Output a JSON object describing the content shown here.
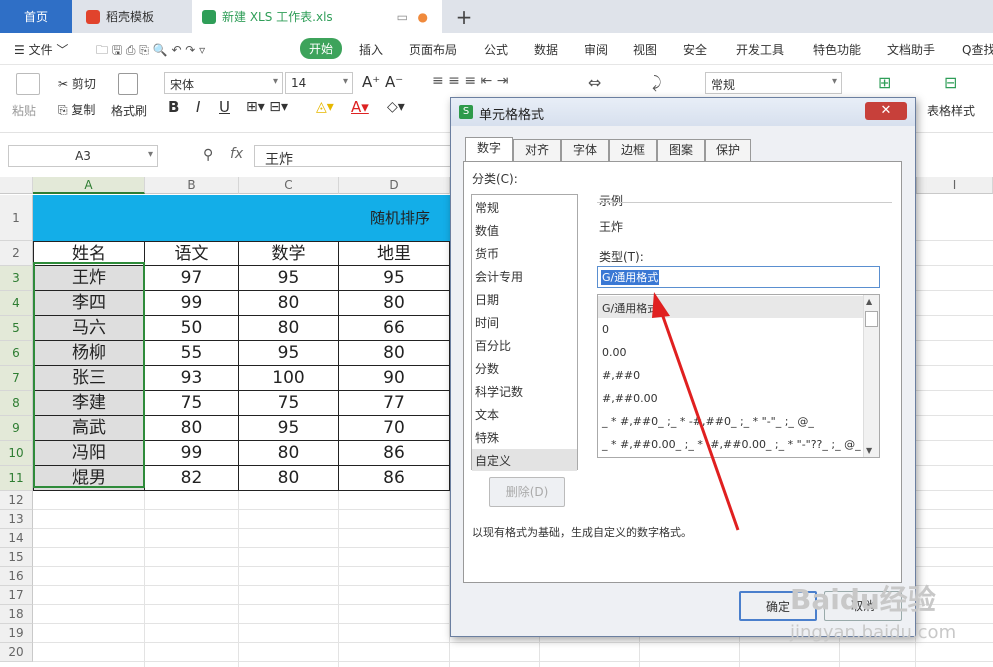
{
  "tabs": {
    "home": "首页",
    "template": "稻壳模板",
    "file": "新建 XLS 工作表.xls",
    "add": "+"
  },
  "menu": {
    "file": "文件",
    "items": [
      "开始",
      "插入",
      "页面布局",
      "公式",
      "数据",
      "审阅",
      "视图",
      "安全",
      "开发工具",
      "特色功能",
      "文档助手"
    ],
    "search": "Q查找"
  },
  "ribbon": {
    "paste": "粘贴",
    "cut": "剪切",
    "copy": "复制",
    "format_painter": "格式刷",
    "font": "宋体",
    "size": "14",
    "number_format": "常规",
    "table_style": "表格样式"
  },
  "formula": {
    "cell": "A3",
    "fx": "fx",
    "value": "王炸"
  },
  "sheet": {
    "columns": [
      "A",
      "B",
      "C",
      "D",
      "I"
    ],
    "rows": [
      "1",
      "2",
      "3",
      "4",
      "5",
      "6",
      "7",
      "8",
      "9",
      "10",
      "11",
      "12",
      "13",
      "14",
      "15",
      "16",
      "17",
      "18",
      "19",
      "20"
    ],
    "title": "随机排序",
    "headers": [
      "姓名",
      "语文",
      "数学",
      "地里"
    ],
    "data": [
      [
        "王炸",
        "97",
        "95",
        "95"
      ],
      [
        "李四",
        "99",
        "80",
        "80"
      ],
      [
        "马六",
        "50",
        "80",
        "66"
      ],
      [
        "杨柳",
        "55",
        "95",
        "80"
      ],
      [
        "张三",
        "93",
        "100",
        "90"
      ],
      [
        "李建",
        "75",
        "75",
        "77"
      ],
      [
        "高武",
        "80",
        "95",
        "70"
      ],
      [
        "冯阳",
        "99",
        "80",
        "86"
      ],
      [
        "焜男",
        "82",
        "80",
        "86"
      ]
    ]
  },
  "dialog": {
    "title": "单元格格式",
    "close": "✕",
    "tabs": [
      "数字",
      "对齐",
      "字体",
      "边框",
      "图案",
      "保护"
    ],
    "category_label": "分类(C):",
    "categories": [
      "常规",
      "数值",
      "货币",
      "会计专用",
      "日期",
      "时间",
      "百分比",
      "分数",
      "科学记数",
      "文本",
      "特殊",
      "自定义"
    ],
    "sample_label": "示例",
    "sample_value": "王炸",
    "type_label": "类型(T):",
    "type_value": "G/通用格式",
    "types": [
      "G/通用格式",
      "0",
      "0.00",
      "#,##0",
      "#,##0.00",
      "_ * #,##0_ ;_ * -#,##0_ ;_ * \"-\"_ ;_ @_",
      "_ * #,##0.00_ ;_ * -#,##0.00_ ;_ * \"-\"??_ ;_ @_"
    ],
    "delete": "删除(D)",
    "description": "以现有格式为基础，生成自定义的数字格式。",
    "ok": "确定",
    "cancel": "取消"
  },
  "watermark": {
    "brand": "Baidu经验",
    "url": "jingyan.baidu.com"
  }
}
